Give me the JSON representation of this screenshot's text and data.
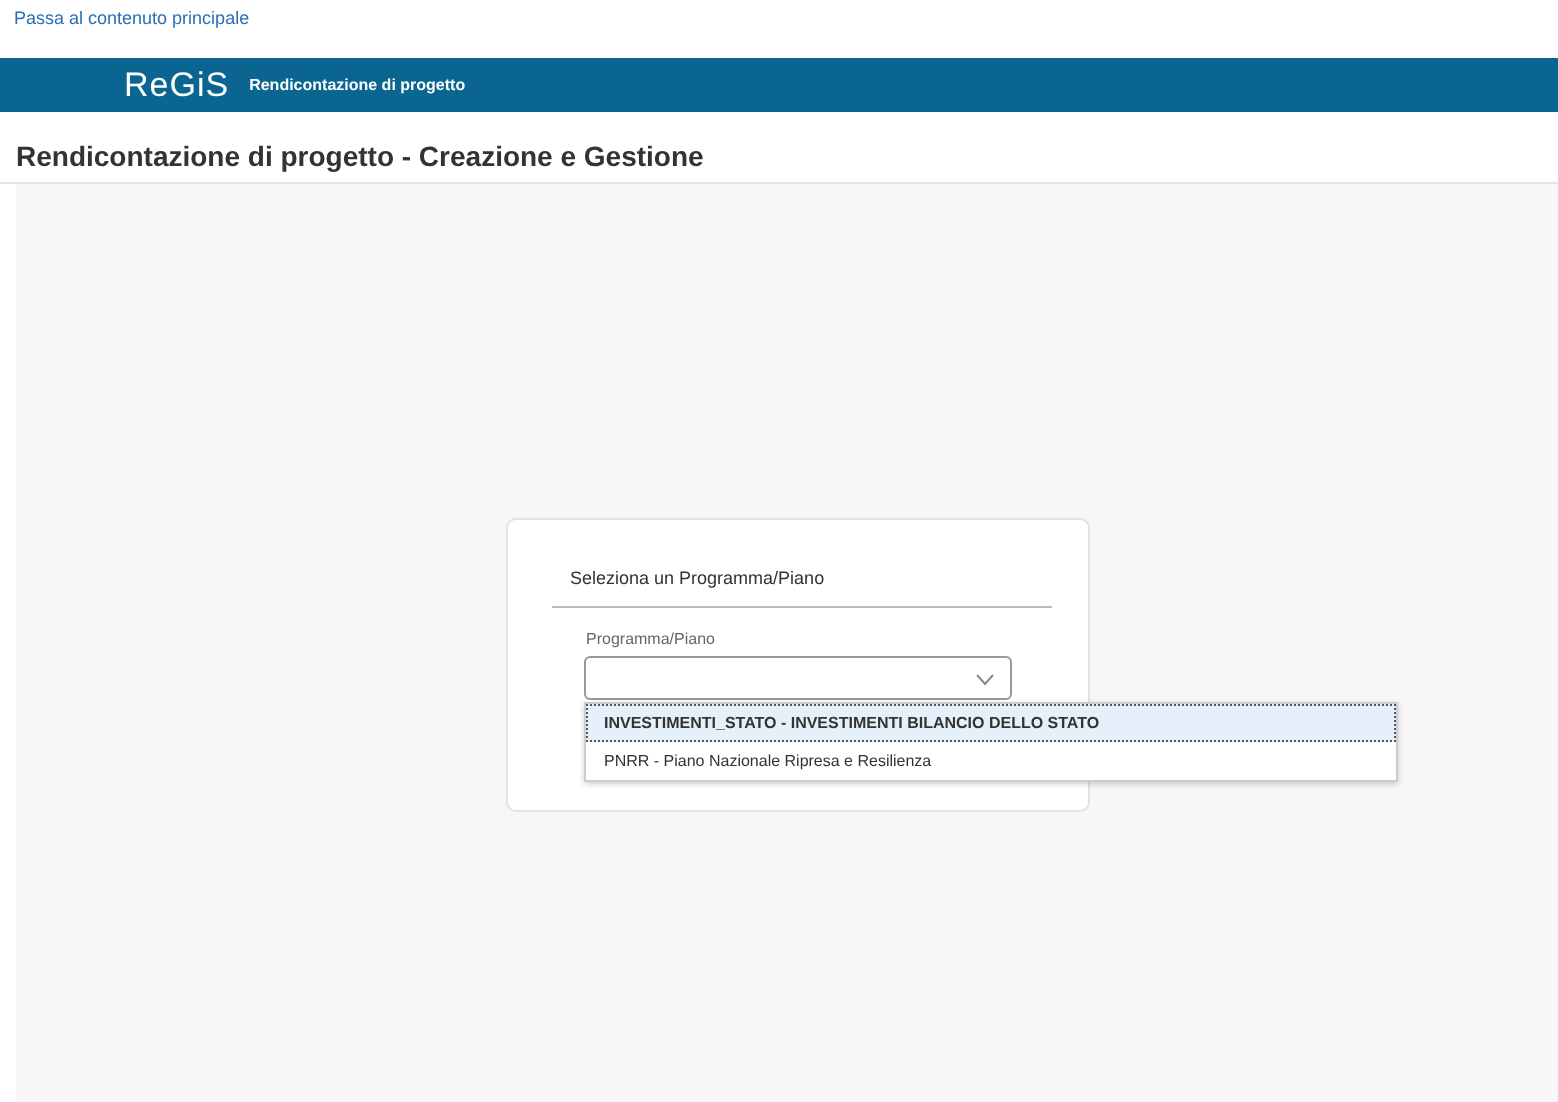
{
  "skip_link": "Passa al contenuto principale",
  "header": {
    "logo": "ReGiS",
    "app_title": "Rendicontazione di progetto"
  },
  "page_title": "Rendicontazione di progetto - Creazione e Gestione",
  "card": {
    "title": "Seleziona un Programma/Piano",
    "field_label": "Programma/Piano",
    "options": [
      {
        "label": "INVESTIMENTI_STATO - INVESTIMENTI BILANCIO DELLO STATO",
        "selected": true
      },
      {
        "label": "PNRR - Piano Nazionale Ripresa e Resilienza",
        "selected": false
      }
    ]
  }
}
